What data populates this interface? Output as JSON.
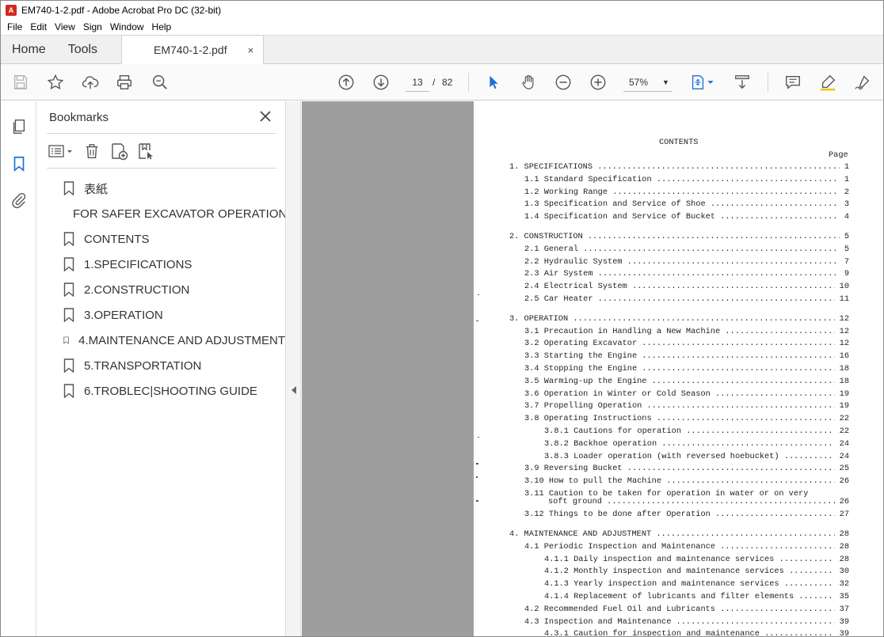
{
  "window": {
    "title": "EM740-1-2.pdf - Adobe Acrobat Pro DC (32-bit)"
  },
  "menu": [
    "File",
    "Edit",
    "View",
    "Sign",
    "Window",
    "Help"
  ],
  "tabs": {
    "home": "Home",
    "tools": "Tools",
    "document": "EM740-1-2.pdf",
    "close": "×"
  },
  "toolbar": {
    "page_current": "13",
    "page_sep": "/",
    "page_total": "82",
    "zoom": "57%"
  },
  "bookmarks": {
    "title": "Bookmarks",
    "items": [
      "表紙",
      "FOR SAFER EXCAVATOR OPERATION",
      "CONTENTS",
      "1.SPECIFICATIONS",
      "2.CONSTRUCTION",
      "3.OPERATION",
      "4.MAINTENANCE AND ADJUSTMENT",
      "5.TRANSPORTATION",
      "6.TROBLEC|SHOOTING GUIDE"
    ]
  },
  "pdf": {
    "heading": "CONTENTS",
    "page_label": "Page",
    "toc": [
      {
        "text": "1. SPECIFICATIONS",
        "page": "1",
        "indent": 0
      },
      {
        "text": "1.1 Standard Specification",
        "page": "1",
        "indent": 1
      },
      {
        "text": "1.2 Working Range",
        "page": "2",
        "indent": 1
      },
      {
        "text": "1.3 Specification and Service of Shoe",
        "page": "3",
        "indent": 1
      },
      {
        "text": "1.4 Specification and Service of Bucket",
        "page": "4",
        "indent": 1
      },
      {
        "text": "2. CONSTRUCTION",
        "page": "5",
        "indent": 0
      },
      {
        "text": "2.1 General",
        "page": "5",
        "indent": 1
      },
      {
        "text": "2.2 Hydraulic System",
        "page": "7",
        "indent": 1
      },
      {
        "text": "2.3 Air System",
        "page": "9",
        "indent": 1
      },
      {
        "text": "2.4 Electrical System",
        "page": "10",
        "indent": 1
      },
      {
        "text": "2.5 Car Heater",
        "page": "11",
        "indent": 1
      },
      {
        "text": "3. OPERATION",
        "page": "12",
        "indent": 0
      },
      {
        "text": "3.1 Precaution in Handling a New Machine",
        "page": "12",
        "indent": 1
      },
      {
        "text": "3.2 Operating Excavator",
        "page": "12",
        "indent": 1
      },
      {
        "text": "3.3 Starting the Engine",
        "page": "16",
        "indent": 1
      },
      {
        "text": "3.4 Stopping the Engine",
        "page": "18",
        "indent": 1
      },
      {
        "text": "3.5 Warming-up the Engine",
        "page": "18",
        "indent": 1
      },
      {
        "text": "3.6 Operation in Winter or Cold Season",
        "page": "19",
        "indent": 1
      },
      {
        "text": "3.7 Propelling Operation",
        "page": "19",
        "indent": 1
      },
      {
        "text": "3.8 Operating Instructions",
        "page": "22",
        "indent": 1
      },
      {
        "text": "3.8.1 Cautions for operation",
        "page": "22",
        "indent": 2
      },
      {
        "text": "3.8.2 Backhoe operation",
        "page": "24",
        "indent": 2
      },
      {
        "text": "3.8.3 Loader operation (with reversed hoebucket)",
        "page": "24",
        "indent": 2
      },
      {
        "text": "3.9 Reversing Bucket",
        "page": "25",
        "indent": 1
      },
      {
        "text": "3.10 How to pull the Machine",
        "page": "26",
        "indent": 1
      },
      {
        "text": "3.11 Caution to be taken for operation in water or on very",
        "page": "",
        "indent": 1
      },
      {
        "text": "soft ground",
        "page": "26",
        "indent": 3
      },
      {
        "text": "3.12 Things to be done after Operation",
        "page": "27",
        "indent": 1
      },
      {
        "text": "4. MAINTENANCE AND ADJUSTMENT",
        "page": "28",
        "indent": 0
      },
      {
        "text": "4.1 Periodic Inspection and Maintenance",
        "page": "28",
        "indent": 1
      },
      {
        "text": "4.1.1 Daily inspection and maintenance services",
        "page": "28",
        "indent": 2
      },
      {
        "text": "4.1.2 Monthly inspection and maintenance services",
        "page": "30",
        "indent": 2
      },
      {
        "text": "4.1.3 Yearly inspection and maintenance services",
        "page": "32",
        "indent": 2
      },
      {
        "text": "4.1.4 Replacement of lubricants and filter elements",
        "page": "35",
        "indent": 2
      },
      {
        "text": "4.2 Recommended Fuel Oil and Lubricants",
        "page": "37",
        "indent": 1
      },
      {
        "text": "4.3 Inspection and Maintenance",
        "page": "39",
        "indent": 1
      },
      {
        "text": "4.3.1 Caution for inspection and maintenance",
        "page": "39",
        "indent": 2
      }
    ]
  }
}
